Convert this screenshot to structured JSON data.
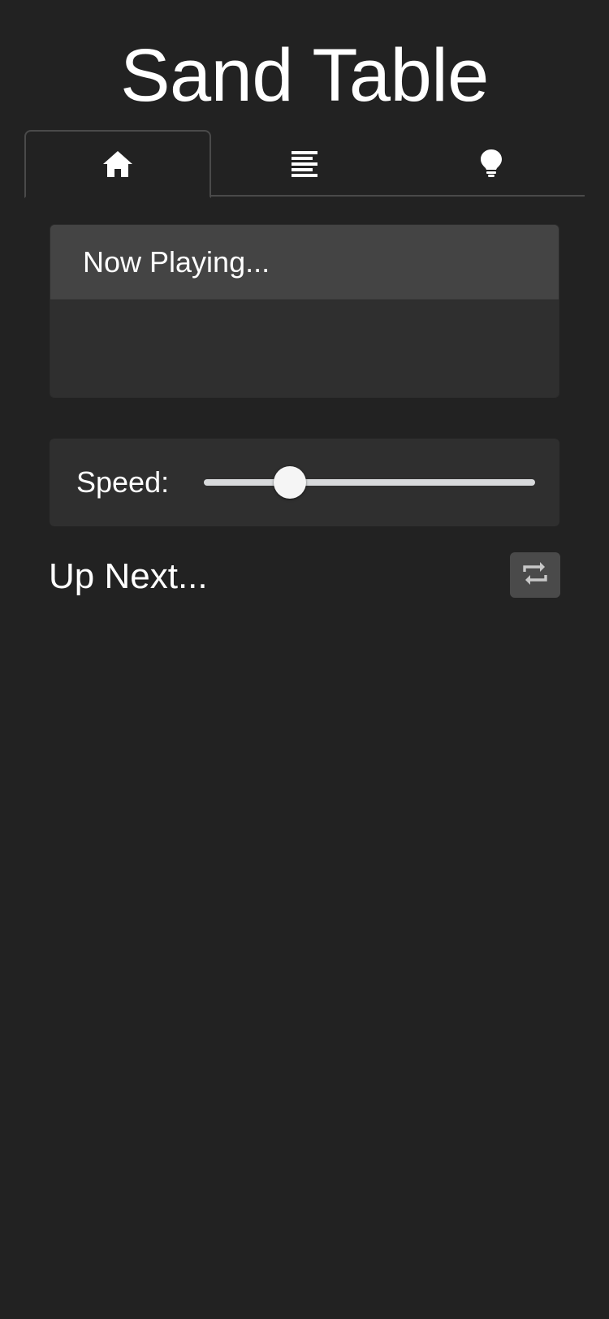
{
  "app": {
    "title": "Sand Table"
  },
  "tabs": [
    {
      "icon": "home-icon",
      "active": true
    },
    {
      "icon": "list-icon",
      "active": false
    },
    {
      "icon": "lightbulb-icon",
      "active": false
    }
  ],
  "now_playing": {
    "header": "Now Playing..."
  },
  "speed": {
    "label": "Speed:",
    "value_fraction": 0.26
  },
  "up_next": {
    "title": "Up Next...",
    "repeat_icon": "repeat-icon"
  },
  "colors": {
    "background": "#222222",
    "card": "#2f2f2f",
    "card_header": "#444444",
    "button": "#4a4a4a",
    "text": "#ffffff"
  }
}
